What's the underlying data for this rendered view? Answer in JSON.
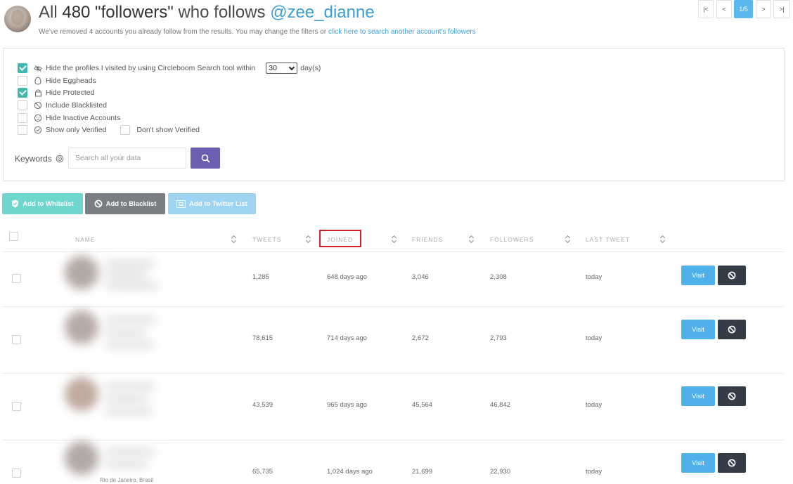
{
  "header": {
    "title_prefix": "All ",
    "count": "480",
    "title_quoted": " \"followers\"",
    "title_mid": " who follows ",
    "handle": "@zee_dianne",
    "subtitle": "We've removed 4 accounts you already follow from the results. You may change the filters or ",
    "subtitle_link": "click here to search another account's followers"
  },
  "filters": {
    "hide_visited": {
      "label": "Hide the profiles I visited by using Circleboom Search tool within",
      "checked": true,
      "days_value": "30",
      "suffix": "day(s)"
    },
    "hide_eggheads": {
      "label": "Hide Eggheads",
      "checked": false
    },
    "hide_protected": {
      "label": "Hide Protected",
      "checked": true
    },
    "include_blacklisted": {
      "label": "Include Blacklisted",
      "checked": false
    },
    "hide_inactive": {
      "label": "Hide Inactive Accounts",
      "checked": false
    },
    "show_verified": {
      "label": "Show only Verified",
      "checked": false
    },
    "dont_show_verified": {
      "label": "Don't show Verified",
      "checked": false
    }
  },
  "search": {
    "label": "Keywords",
    "placeholder": "Search all your data"
  },
  "actions": {
    "whitelist": "Add to Whitelist",
    "blacklist": "Add to Blacklist",
    "twitter_list": "Add to Twitter List"
  },
  "pagination": {
    "first": "|<",
    "prev": "<",
    "current": "1/5",
    "next": ">",
    "last": ">|"
  },
  "table": {
    "columns": [
      "NAME",
      "TWEETS",
      "JOINED",
      "FRIENDS",
      "FOLLOWERS",
      "LAST TWEET"
    ],
    "rows": [
      {
        "tweets": "1,285",
        "joined": "648 days ago",
        "friends": "3,046",
        "followers": "2,308",
        "last_tweet": "today",
        "visit": "Visit"
      },
      {
        "tweets": "78,615",
        "joined": "714 days ago",
        "friends": "2,672",
        "followers": "2,793",
        "last_tweet": "today",
        "visit": "Visit"
      },
      {
        "tweets": "43,539",
        "joined": "965 days ago",
        "friends": "45,564",
        "followers": "46,842",
        "last_tweet": "today",
        "visit": "Visit"
      },
      {
        "tweets": "65,735",
        "joined": "1,024 days ago",
        "friends": "21,699",
        "followers": "22,930",
        "last_tweet": "today",
        "visit": "Visit"
      }
    ],
    "partial_location": "Rio de Janeiro, Brasil"
  },
  "colors": {
    "accent_teal": "#3fb9b0",
    "link_blue": "#3a9fd1",
    "search_purple": "#6b5fb2",
    "visit_blue": "#4fb0ea",
    "block_dark": "#343c47",
    "highlight_red": "#d0212a"
  }
}
